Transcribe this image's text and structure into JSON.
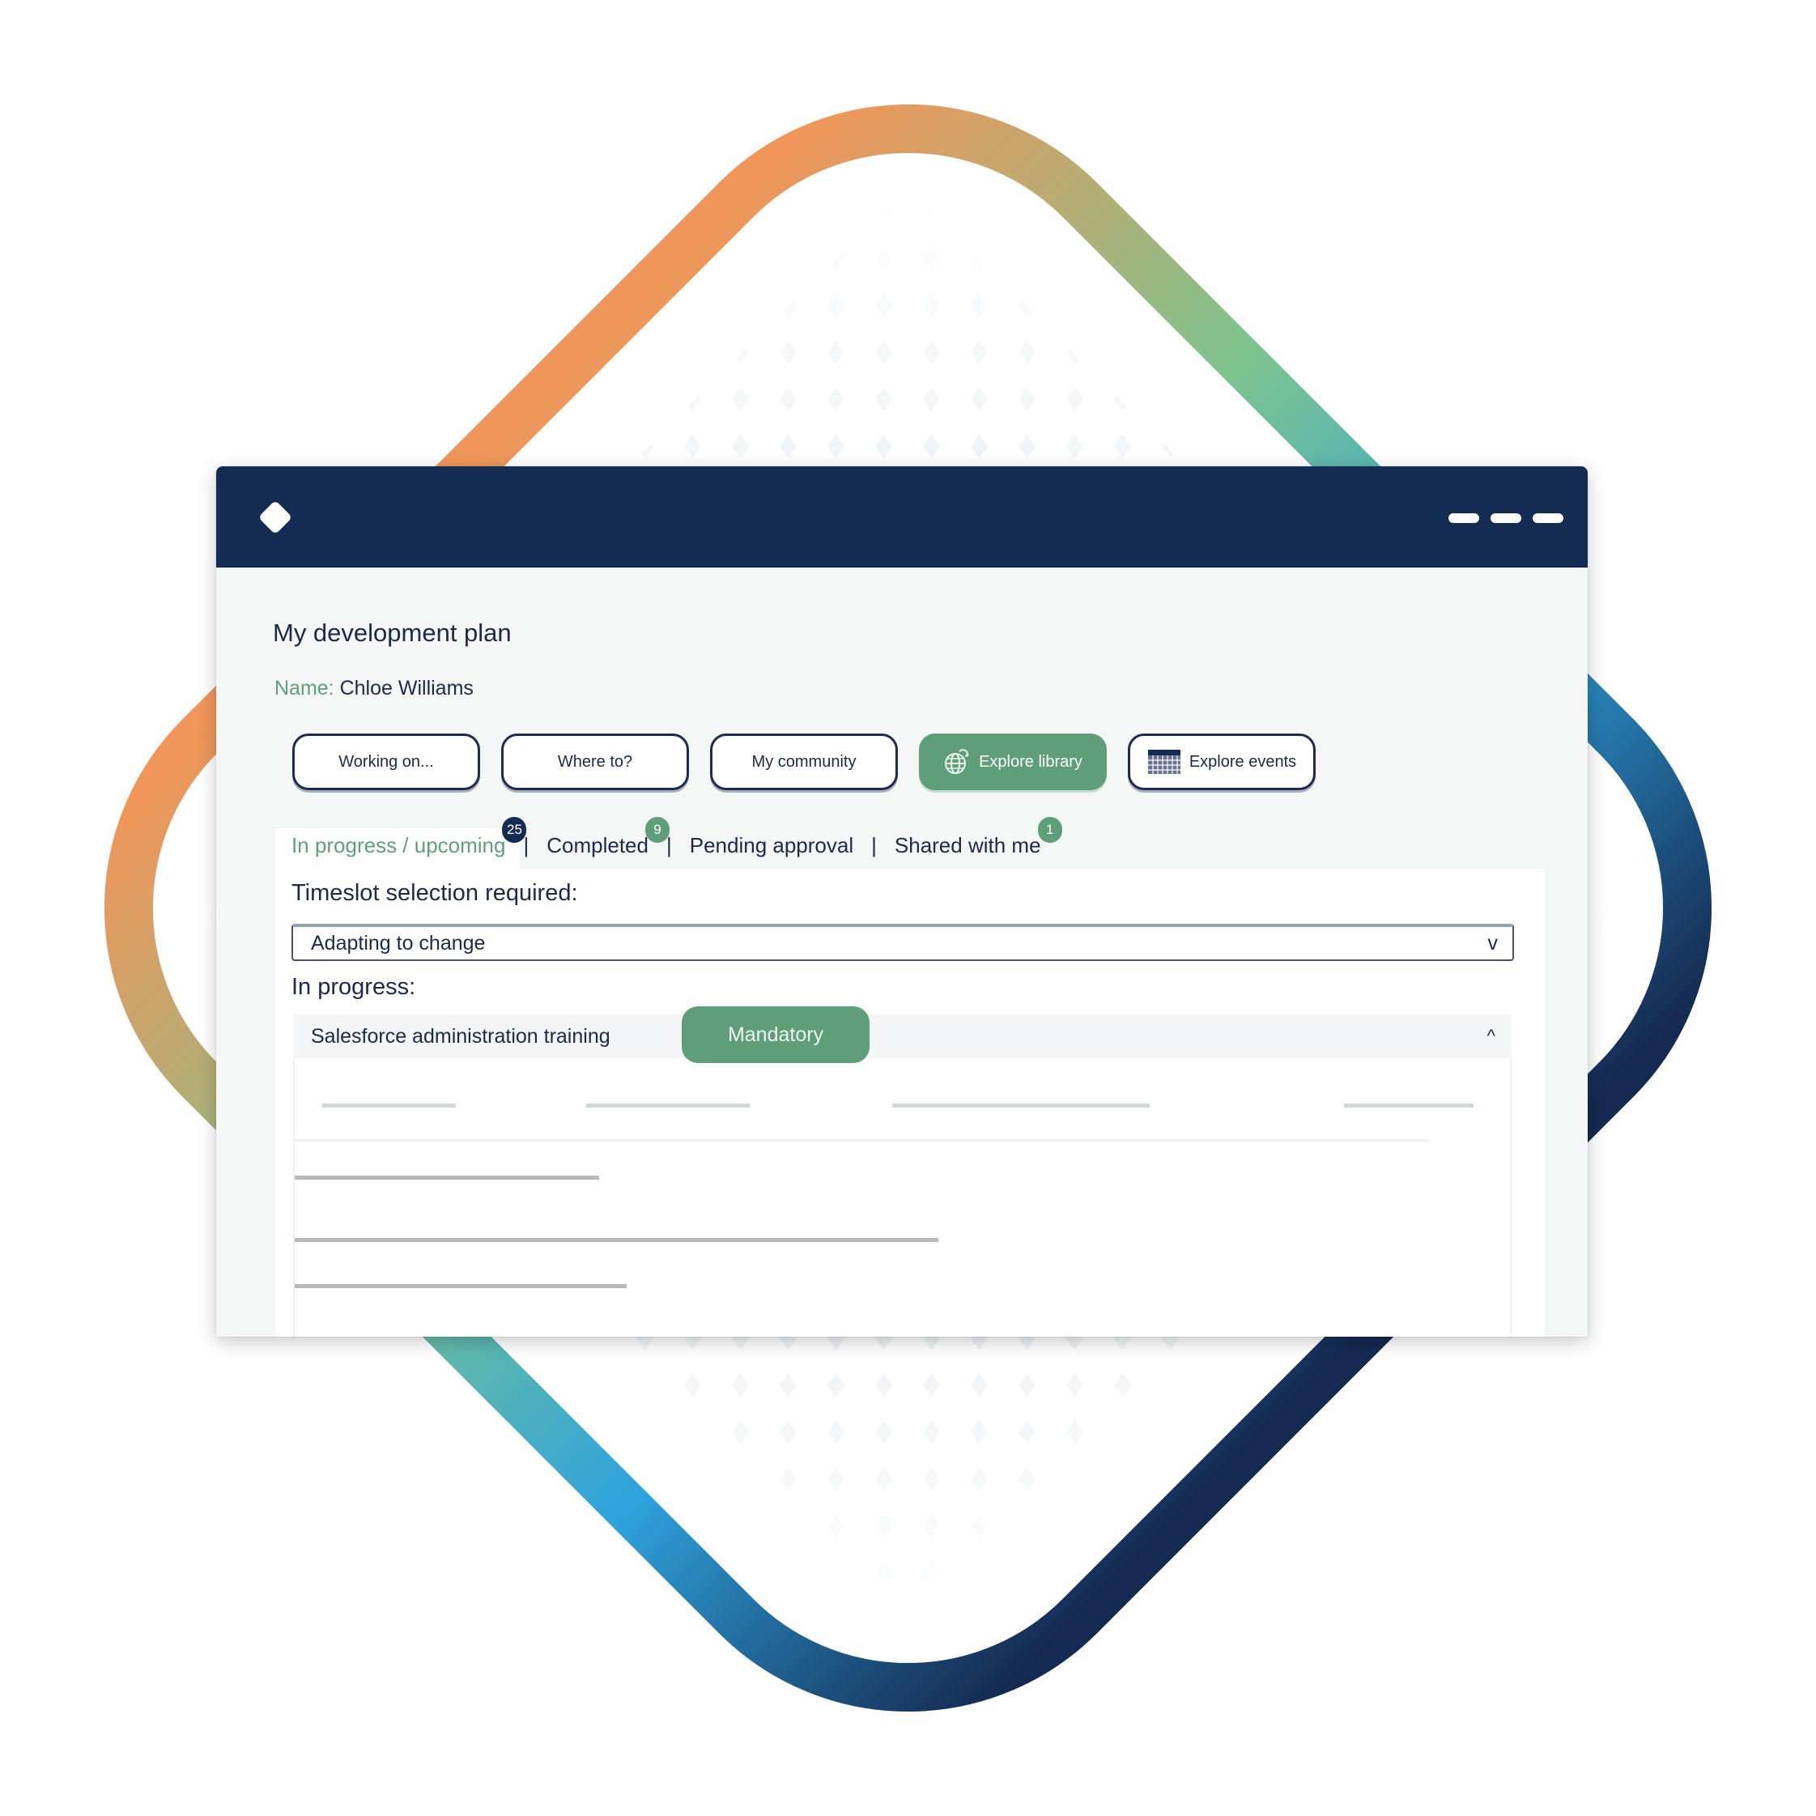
{
  "decor": {
    "frame_gradient": [
      "#f0965a",
      "#7dc48f",
      "#2ea3dc",
      "#152a52"
    ],
    "pattern_color": "#eef1f4"
  },
  "window": {
    "logo_icon": "diamond-logo-icon",
    "controls": [
      "minimize",
      "maximize",
      "close"
    ]
  },
  "page": {
    "title": "My development plan",
    "name_label": "Name:",
    "name_value": "Chloe Williams"
  },
  "nav_buttons": [
    {
      "label": "Working on...",
      "icon": null,
      "active": false
    },
    {
      "label": "Where to?",
      "icon": null,
      "active": false
    },
    {
      "label": "My community",
      "icon": null,
      "active": false
    },
    {
      "label": "Explore library",
      "icon": "globe-icon",
      "active": true
    },
    {
      "label": "Explore events",
      "icon": "calendar-icon",
      "active": false
    }
  ],
  "tabs": [
    {
      "label": "In progress / upcoming",
      "badge": "25",
      "active": true
    },
    {
      "label": "Completed",
      "badge": "9",
      "active": false
    },
    {
      "label": "Pending approval",
      "badge": null,
      "active": false
    },
    {
      "label": "Shared with me",
      "badge": "1",
      "active": false
    }
  ],
  "tab_separator": "|",
  "timeslot": {
    "label": "Timeslot selection required:",
    "selected": "Adapting to change",
    "chevron": "v"
  },
  "in_progress": {
    "label": "In progress:",
    "items": [
      {
        "title": "Salesforce administration training",
        "tag": "Mandatory",
        "toggle": "^"
      }
    ]
  },
  "colors": {
    "navy": "#152c52",
    "green": "#5e9f7a",
    "text": "#1b2a4b"
  }
}
